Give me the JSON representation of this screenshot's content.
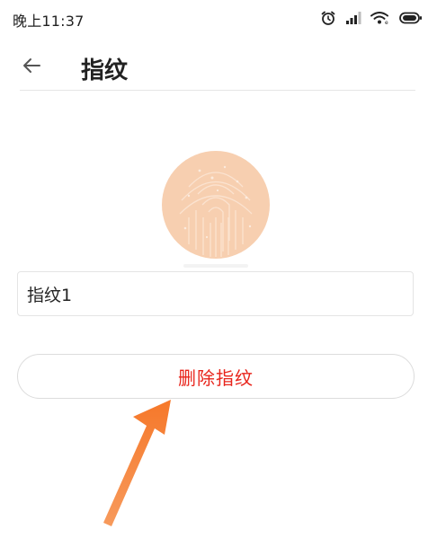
{
  "status_bar": {
    "time": "晚上11:37",
    "icons": [
      "alarm-icon",
      "signal-icon",
      "wifi-icon",
      "battery-icon"
    ]
  },
  "header": {
    "back_icon": "arrow-left-icon",
    "title": "指纹"
  },
  "fingerprint": {
    "icon": "fingerprint-icon",
    "color": "#f7cfb0"
  },
  "name_field": {
    "value": "指纹1"
  },
  "delete_button": {
    "label": "删除指纹",
    "color": "#e8241b"
  },
  "annotation": {
    "arrow_color": "#f57c2b"
  }
}
